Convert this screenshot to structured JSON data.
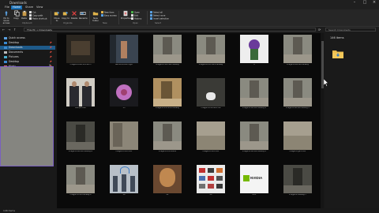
{
  "titlebar": {
    "title": "Downloads"
  },
  "menu": {
    "tabs": [
      "File",
      "Home",
      "Share",
      "View"
    ],
    "active": "Home"
  },
  "ribbon": {
    "buttons": [
      {
        "label": "Pin to Quick access",
        "icon": "pin-icon"
      },
      {
        "label": "Copy",
        "icon": "copy-icon"
      },
      {
        "label": "Paste",
        "icon": "paste-icon"
      },
      {
        "label": "Move to",
        "icon": "move-icon"
      },
      {
        "label": "Copy to",
        "icon": "copy-to-icon"
      },
      {
        "label": "Delete",
        "icon": "delete-icon"
      },
      {
        "label": "Rename",
        "icon": "rename-icon"
      },
      {
        "label": "New folder",
        "icon": "new-folder-icon"
      },
      {
        "label": "Properties",
        "icon": "properties-icon"
      }
    ],
    "clipboard_small": [
      "Cut",
      "Copy path",
      "Paste shortcut"
    ],
    "new_small": [
      "New item",
      "Easy access"
    ],
    "open_small": [
      "Open",
      "Edit",
      "History"
    ],
    "select_small": [
      "Select all",
      "Select none",
      "Invert selection"
    ],
    "groups": [
      "Clipboard",
      "Organize",
      "New",
      "Open",
      "Select"
    ]
  },
  "address": {
    "path": "This PC  >  Downloads",
    "search_placeholder": "Search Downloads"
  },
  "nav": {
    "items": [
      {
        "label": "Quick access",
        "sel": false
      },
      {
        "label": "Desktop",
        "sel": false
      },
      {
        "label": "Downloads",
        "sel": true
      },
      {
        "label": "Documents",
        "sel": false
      },
      {
        "label": "Pictures",
        "sel": false
      },
      {
        "label": "Desktop",
        "sel": false
      },
      {
        "label": "Music",
        "sel": false
      }
    ]
  },
  "files": [
    {
      "name": "imagen4-fast-1b1-a1c5",
      "kind": "room-dim"
    },
    {
      "name": "fashion-shoot-night",
      "kind": "photo-street"
    },
    {
      "name": "imagen4-flux-dev-hallway",
      "kind": "hallway"
    },
    {
      "name": "imagen4-flux-cam-hallway",
      "kind": "hallway"
    },
    {
      "name": "8",
      "kind": "robot"
    },
    {
      "name": "imagen4-vactus-hallway",
      "kind": "hallway"
    },
    {
      "name": "suit-portrait",
      "kind": "suits"
    },
    {
      "name": "15",
      "kind": "virus"
    },
    {
      "name": "imagen4-flux-sdxl-hallway",
      "kind": "hallway-lit"
    },
    {
      "name": "imagen4-flux-sdxl-cat",
      "kind": "cat"
    },
    {
      "name": "imagen4-vactus-hallway-2",
      "kind": "hallway"
    },
    {
      "name": "imagen4-vactus-hallway-3",
      "kind": "hallway"
    },
    {
      "name": "imagen4-vactus-hallway-4",
      "kind": "hallway-dark"
    },
    {
      "name": "imagen4-flux-door",
      "kind": "door"
    },
    {
      "name": "imagen4-flux-stairs",
      "kind": "hallway"
    },
    {
      "name": "imagen4-flux-floor",
      "kind": "floor"
    },
    {
      "name": "imagen4-vactus-hallway-5",
      "kind": "hallway"
    },
    {
      "name": "imagen4-gen-floor",
      "kind": "floor"
    },
    {
      "name": "imagen4-flux-hallway-6",
      "kind": "hallway"
    },
    {
      "name": "16",
      "kind": "wifi"
    },
    {
      "name": "22",
      "kind": "bust"
    },
    {
      "name": "20",
      "kind": "objects"
    },
    {
      "name": "NVP",
      "kind": "nvidia"
    },
    {
      "name": "imagen4-hallway-7",
      "kind": "hallway-dark"
    }
  ],
  "nvidia_text": "NVIDIA",
  "preview": {
    "count": "146 items"
  },
  "status": {
    "text": "146 items"
  }
}
